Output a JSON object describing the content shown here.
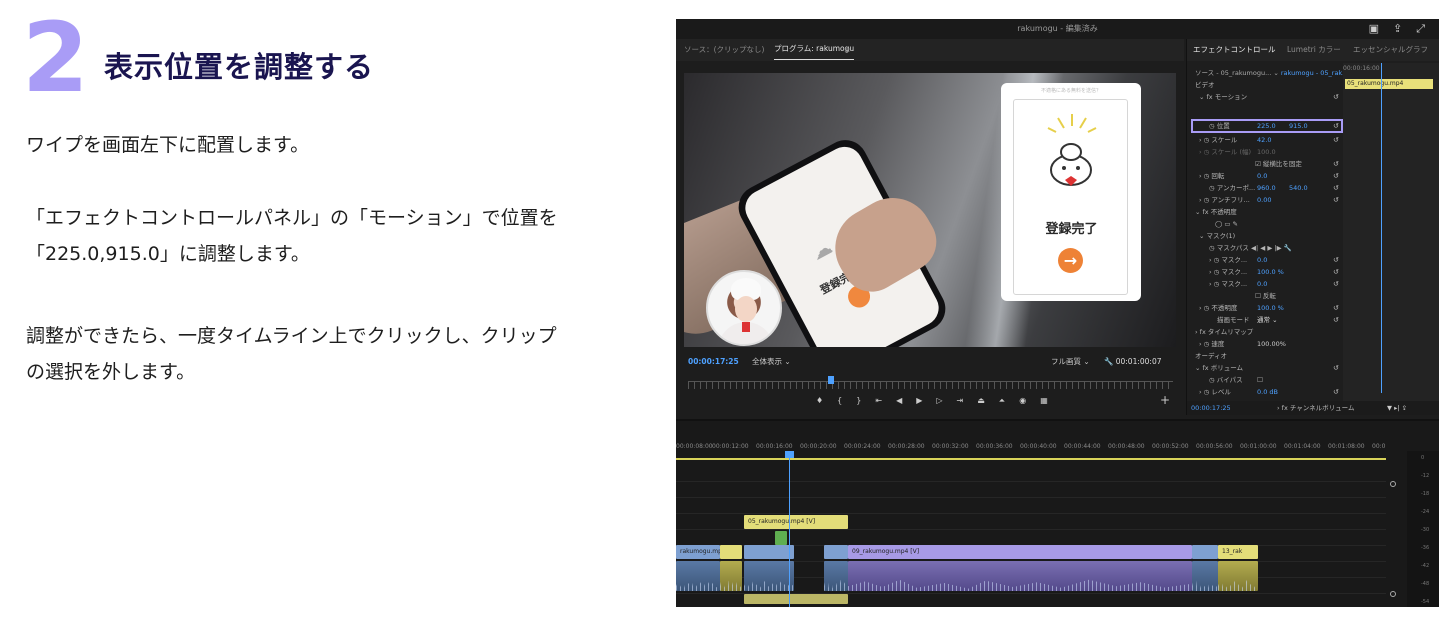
{
  "article": {
    "step_number": "2",
    "title": "表示位置を調整する",
    "p1": "ワイプを画面左下に配置します。",
    "p2_line1": "「エフェクトコントロールパネル」の「モーション」で位置を",
    "p2_line2": "「225.0,915.0」に調整します。",
    "p3_line1": "調整ができたら、一度タイムライン上でクリックし、クリップ",
    "p3_line2": "の選択を外します。"
  },
  "premiere": {
    "window_title": "rakumogu - 編集済み",
    "monitor_tabs": {
      "source": "ソース：(クリップなし)",
      "program": "プログラム: rakumogu"
    },
    "card": {
      "header": "不適格にある無料を送信？",
      "done_text": "登録完了",
      "arrow": "→"
    },
    "phone_text": "登録完了",
    "monitor_bar": {
      "timecode": "00:00:17:25",
      "fit": "全体表示",
      "quality": "フル画質",
      "duration": "00:01:00:07"
    },
    "effect_controls": {
      "tabs": {
        "effect": "エフェクトコントロール",
        "lumetri": "Lumetri カラー",
        "essential": "エッセンシャルグラフ"
      },
      "source_label": "ソース - 05_rakumogu...",
      "sequence_label": "rakumogu - 05_rak...",
      "tl_ruler": "00:00:16:00",
      "tl_clip": "05_rakumogu.mp4",
      "rows": {
        "video": "ビデオ",
        "motion": "モーション",
        "position": "位置",
        "position_x": "225.0",
        "position_y": "915.0",
        "scale": "スケール",
        "scale_v": "42.0",
        "scale_w": "スケール (幅)",
        "scale_w_v": "100.0",
        "uniform": "縦横比を固定",
        "rotation": "回転",
        "rotation_v": "0.0",
        "anchor": "アンカーポ...",
        "anchor_x": "960.0",
        "anchor_y": "540.0",
        "antiflicker": "アンチフリ...",
        "antiflicker_v": "0.00",
        "opacity_header": "不透明度",
        "mask": "マスク(1)",
        "mask_path": "マスクパス",
        "mask_feather": "マスク...",
        "mask_feather_v": "0.0",
        "mask_opacity": "マスク...",
        "mask_opacity_v": "100.0 %",
        "mask_expand": "マスク...",
        "mask_expand_v": "0.0",
        "invert": "反転",
        "opacity": "不透明度",
        "opacity_v": "100.0 %",
        "blend": "描画モード",
        "blend_v": "通常",
        "time_remap": "タイムリマップ",
        "speed": "速度",
        "speed_v": "100.00%",
        "audio": "オーディオ",
        "volume": "ボリューム",
        "bypass": "バイパス",
        "level": "レベル",
        "level_v": "0.0 dB",
        "channel_volume": "チャンネルボリューム"
      },
      "bottom_timecode": "00:00:17:25"
    },
    "timeline": {
      "ruler": [
        "00:00:08:00",
        "00:00:12:00",
        "00:00:16:00",
        "00:00:20:00",
        "00:00:24:00",
        "00:00:28:00",
        "00:00:32:00",
        "00:00:36:00",
        "00:00:40:00",
        "00:00:44:00",
        "00:00:48:00",
        "00:00:52:00",
        "00:00:56:00",
        "00:01:00:00",
        "00:01:04:00",
        "00:01:08:00",
        "00:0"
      ],
      "clip_v2": "05_rakumogu.mp4 [V]",
      "clip_v1_left": "rakumogu.mp4",
      "clip_v1_mid": "09_rakumogu.mp4 [V]",
      "clip_v1_right": "13_rak",
      "meter": [
        "0",
        "-12",
        "-18",
        "-24",
        "-30",
        "-36",
        "-42",
        "-48",
        "-54"
      ]
    }
  }
}
